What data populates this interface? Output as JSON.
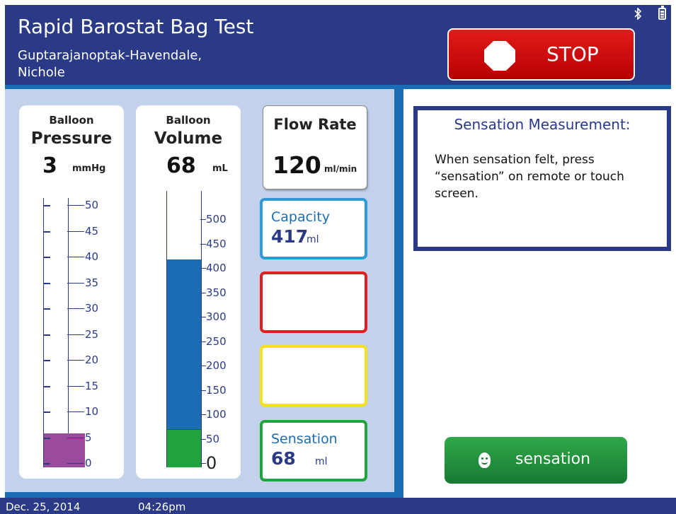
{
  "header": {
    "title": "Rapid Barostat Bag Test",
    "patient_name_line1": "Guptarajanoptak-Havendale,",
    "patient_name_line2": "Nichole",
    "bluetooth_icon": "bluetooth-icon",
    "battery_icon": "battery-icon",
    "stop_button": {
      "label": "STOP",
      "icon": "stop-octagon-icon",
      "color": "#d80d0d"
    }
  },
  "gauges": {
    "pressure": {
      "title_small": "Balloon",
      "title_big": "Pressure",
      "value": "3",
      "unit": "mmHg",
      "level": 3,
      "max": 50,
      "tick_labels": [
        "50",
        "45",
        "40",
        "35",
        "30",
        "25",
        "20",
        "15",
        "10",
        "5",
        "0"
      ],
      "fill_color": "#9b4b9c"
    },
    "volume": {
      "title_small": "Balloon",
      "title_big": "Volume",
      "value": "68",
      "unit": "mL",
      "level": 68,
      "capacity_level": 417,
      "tick_labels": [
        "500",
        "450",
        "400",
        "350",
        "300",
        "250",
        "200",
        "150",
        "100",
        "50",
        "0"
      ],
      "fill_color": "#1b6db3",
      "sensation_color": "#21a33d"
    }
  },
  "flow_rate": {
    "label": "Flow Rate",
    "value": "120",
    "unit": "ml/min"
  },
  "capacity": {
    "label": "Capacity",
    "value": "417",
    "unit": "ml",
    "color": "#2e9ad8"
  },
  "alert_boxes": [
    {
      "color": "#e02020"
    },
    {
      "color": "#f3e21c"
    }
  ],
  "sensation": {
    "label": "Sensation",
    "value": "68",
    "unit": "ml",
    "color": "#21a33d"
  },
  "instructions": {
    "title": "Sensation Measurement:",
    "text": "When sensation felt, press “sensation” on remote or touch screen."
  },
  "sensation_button": {
    "label": "sensation",
    "icon": "face-icon"
  },
  "footer": {
    "date": "Dec. 25, 2014",
    "time": "04:26pm"
  }
}
